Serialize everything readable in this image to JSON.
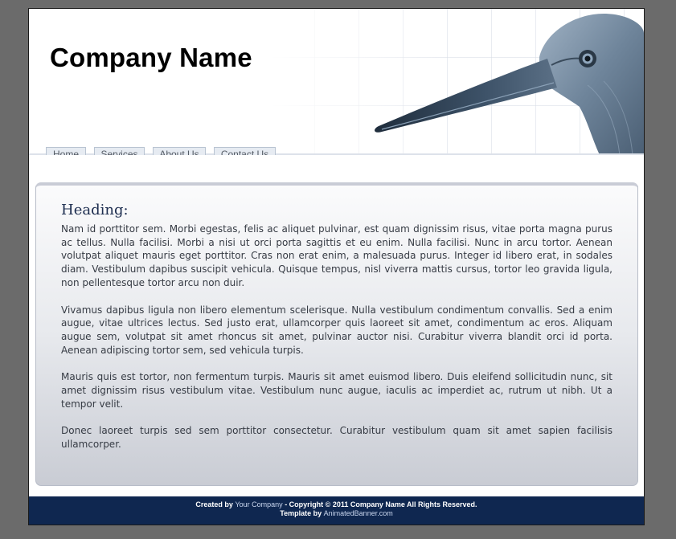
{
  "header": {
    "company_name": "Company Name"
  },
  "nav": {
    "items": [
      {
        "label": "Home"
      },
      {
        "label": "Services"
      },
      {
        "label": "About Us"
      },
      {
        "label": "Contact Us"
      }
    ]
  },
  "main": {
    "heading": "Heading:",
    "paragraphs": [
      "Nam id porttitor sem. Morbi egestas, felis ac aliquet pulvinar, est quam dignissim risus, vitae porta magna purus ac tellus. Nulla facilisi. Morbi a nisi ut orci porta sagittis et eu enim. Nulla facilisi. Nunc in arcu tortor. Aenean volutpat aliquet mauris eget porttitor. Cras non erat enim, a malesuada purus. Integer id libero erat, in sodales diam. Vestibulum dapibus suscipit vehicula. Quisque tempus, nisl viverra mattis cursus, tortor leo gravida ligula, non pellentesque tortor arcu non duir.",
      "Vivamus dapibus ligula non libero elementum scelerisque. Nulla vestibulum condimentum convallis. Sed a enim augue, vitae ultrices lectus. Sed justo erat, ullamcorper quis laoreet sit amet, condimentum ac eros. Aliquam augue sem, volutpat sit amet rhoncus sit amet, pulvinar auctor nisi. Curabitur viverra blandit orci id porta. Aenean adipiscing tortor sem, sed vehicula turpis.",
      "Mauris quis est tortor, non fermentum turpis. Mauris sit amet euismod libero. Duis eleifend sollicitudin nunc, sit amet dignissim risus vestibulum vitae. Vestibulum nunc augue, iaculis ac imperdiet ac, rutrum ut nibh. Ut a tempor velit.",
      "Donec laoreet turpis sed sem porttitor consectetur. Curabitur vestibulum quam sit amet sapien facilisis ullamcorper."
    ]
  },
  "footer": {
    "created_by": "Created by",
    "your_company": "Your Company",
    "copyright": "- Copyright © 2011 Company Name All Rights Reserved.",
    "template_by": "Template by",
    "animated_banner": "AnimatedBanner.com"
  },
  "colors": {
    "background": "#6b6b6b",
    "footer": "#0f2750",
    "heading": "#1d2d4f",
    "nav_button": "#e6ebf2"
  },
  "icons": {
    "header_image": "heron-head"
  }
}
